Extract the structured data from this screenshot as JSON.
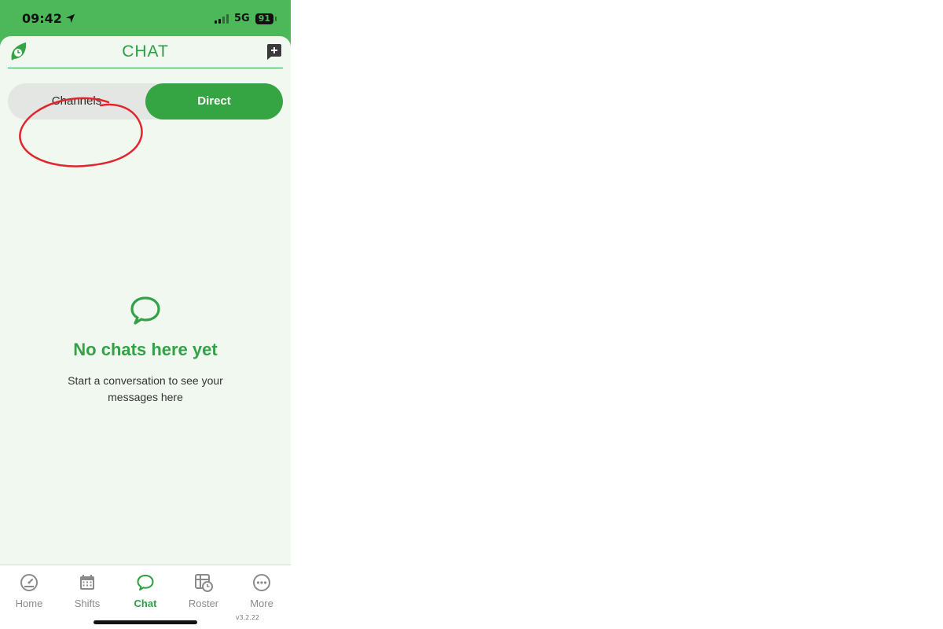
{
  "status_bar": {
    "time": "09:42",
    "network": "5G",
    "battery": "91"
  },
  "header": {
    "title": "CHAT",
    "logo_icon": "leaf-clock-icon",
    "new_chat_icon": "new-chat-icon"
  },
  "segmented_control": {
    "options": [
      {
        "label": "Channels",
        "selected": false
      },
      {
        "label": "Direct",
        "selected": true
      }
    ]
  },
  "empty_state": {
    "icon": "speech-bubble-icon",
    "heading": "No chats here yet",
    "message": "Start a conversation to see your messages here"
  },
  "tab_bar": {
    "items": [
      {
        "label": "Home",
        "icon": "dashboard-gauge-icon"
      },
      {
        "label": "Shifts",
        "icon": "calendar-icon"
      },
      {
        "label": "Chat",
        "icon": "chat-bubble-icon",
        "active": true
      },
      {
        "label": "Roster",
        "icon": "roster-clock-icon"
      },
      {
        "label": "More",
        "icon": "more-dots-icon"
      }
    ],
    "version": "v3.2.22"
  },
  "annotation": {
    "type": "red-circle",
    "target": "Channels"
  },
  "colors": {
    "brand_green": "#35a443",
    "status_green": "#4cb85a",
    "background": "#f1f8f0",
    "annotation_red": "#e0262d"
  }
}
